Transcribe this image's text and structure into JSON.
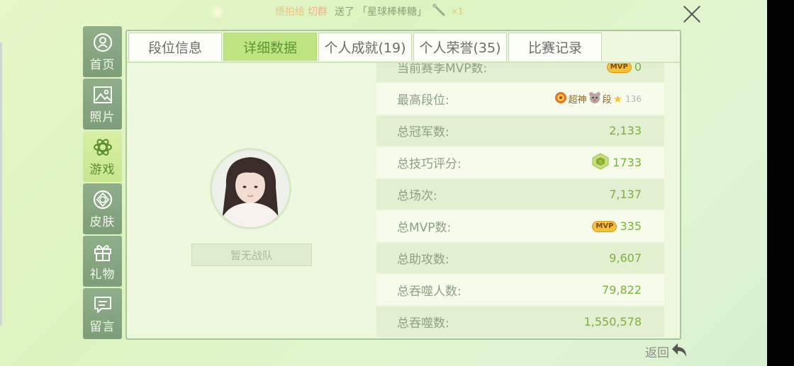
{
  "ticker": {
    "sender": "悟拍给",
    "recipient": "切群",
    "action": "送了",
    "item": "「星球棒棒糖」",
    "count": "×1"
  },
  "sidebar": [
    {
      "label": "首页",
      "icon": "user-circle-icon",
      "active": false
    },
    {
      "label": "照片",
      "icon": "photo-icon",
      "active": false
    },
    {
      "label": "游戏",
      "icon": "atom-icon",
      "active": true
    },
    {
      "label": "皮肤",
      "icon": "diamond-icon",
      "active": false
    },
    {
      "label": "礼物",
      "icon": "gift-icon",
      "active": false
    },
    {
      "label": "留言",
      "icon": "message-icon",
      "active": false
    }
  ],
  "tabs": [
    {
      "label": "段位信息",
      "active": false
    },
    {
      "label": "详细数据",
      "active": true
    },
    {
      "label": "个人成就(19)",
      "active": false
    },
    {
      "label": "个人荣誉(35)",
      "active": false
    },
    {
      "label": "比赛记录",
      "active": false
    }
  ],
  "team": {
    "label": "暂无战队"
  },
  "stats": {
    "season_mvp": {
      "label": "当前赛季MVP数:",
      "badge": "MVP",
      "value": "0"
    },
    "highest_rank": {
      "label": "最高段位:",
      "rank_a": "超神",
      "rank_b": "段",
      "stars": "136"
    },
    "champions": {
      "label": "总冠军数:",
      "value": "2,133"
    },
    "skill": {
      "label": "总技巧评分:",
      "value": "1733"
    },
    "games": {
      "label": "总场次:",
      "value": "7,137"
    },
    "mvp": {
      "label": "总MVP数:",
      "badge": "MVP",
      "value": "335"
    },
    "assists": {
      "label": "总助攻数:",
      "value": "9,607"
    },
    "players_eaten": {
      "label": "总吞噬人数:",
      "value": "79,822"
    },
    "total_eaten": {
      "label": "总吞噬数:",
      "value": "1,550,578"
    }
  },
  "back": {
    "label": "返回"
  },
  "colors": {
    "accent": "#7bb23e",
    "tab_active": "#bfe583",
    "sidebar": "#8fae8a"
  }
}
